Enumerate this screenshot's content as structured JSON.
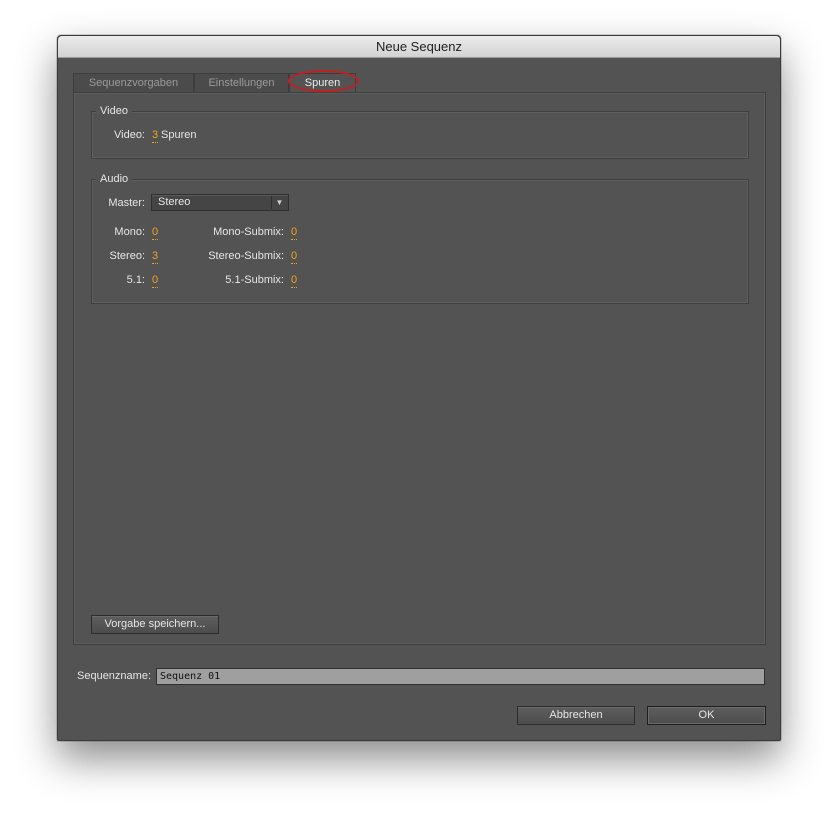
{
  "window": {
    "title": "Neue Sequenz"
  },
  "tabs": [
    {
      "label": "Sequenzvorgaben",
      "active": false
    },
    {
      "label": "Einstellungen",
      "active": false
    },
    {
      "label": "Spuren",
      "active": true
    }
  ],
  "video": {
    "title": "Video",
    "label": "Video:",
    "value": "3",
    "unit": "Spuren"
  },
  "audio": {
    "title": "Audio",
    "master_label": "Master:",
    "master_value": "Stereo",
    "mono_label": "Mono:",
    "mono_value": "0",
    "stereo_label": "Stereo:",
    "stereo_value": "3",
    "surround_label": "5.1:",
    "surround_value": "0",
    "mono_submix_label": "Mono-Submix:",
    "mono_submix_value": "0",
    "stereo_submix_label": "Stereo-Submix:",
    "stereo_submix_value": "0",
    "surround_submix_label": "5.1-Submix:",
    "surround_submix_value": "0"
  },
  "save_preset_label": "Vorgabe speichern...",
  "sequence_name": {
    "label": "Sequenzname:",
    "value": "Sequenz 01"
  },
  "buttons": {
    "cancel": "Abbrechen",
    "ok": "OK"
  },
  "colors": {
    "accent_value": "#f0a31e",
    "highlight_circle": "#c41f1f",
    "panel_bg": "#535353"
  },
  "icons": {
    "dropdown": "chevron-down-icon"
  }
}
